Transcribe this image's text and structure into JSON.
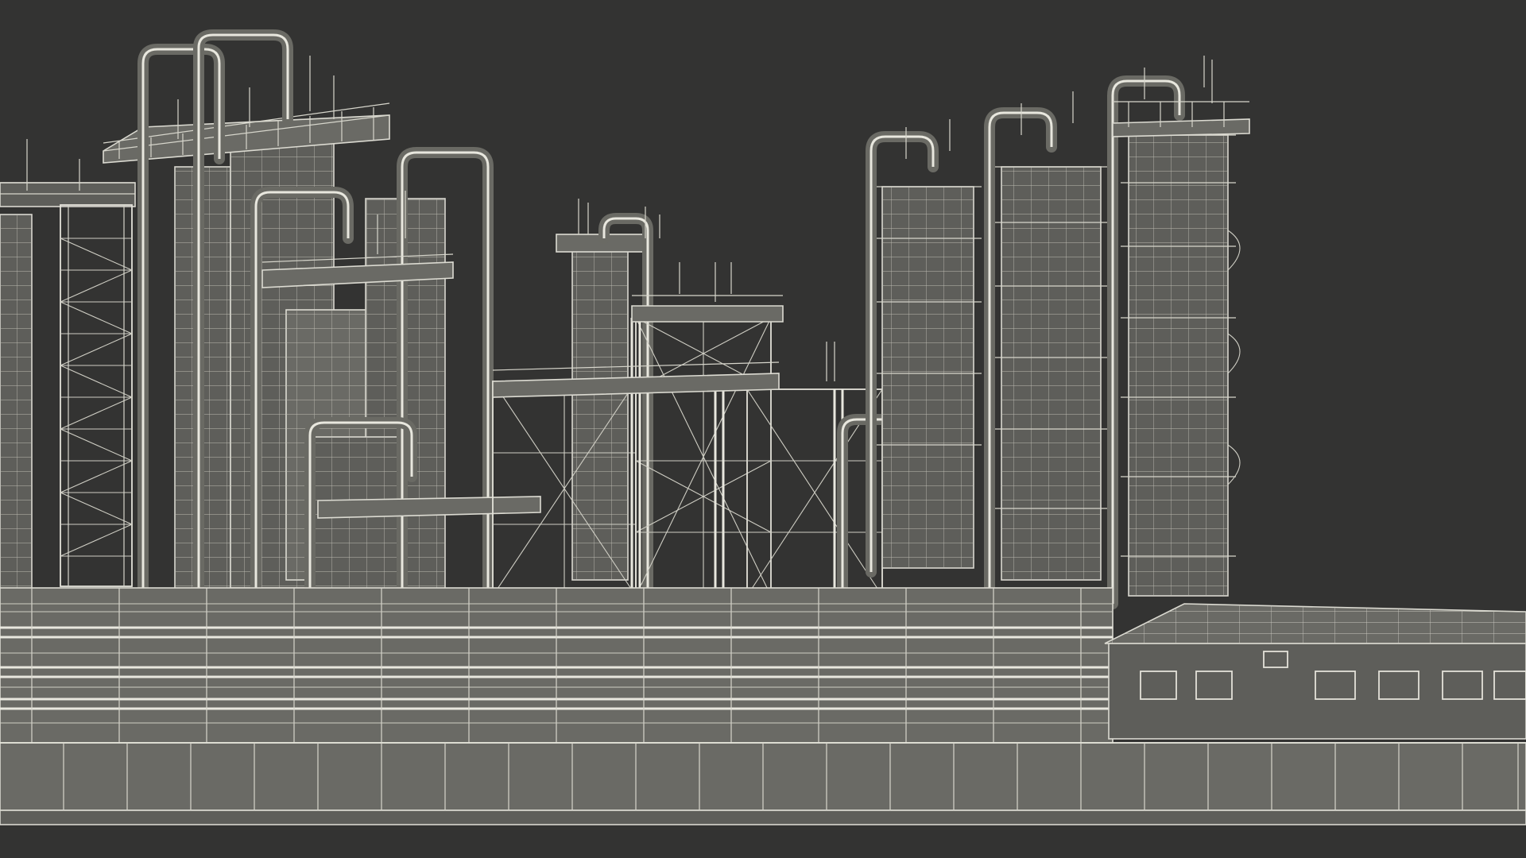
{
  "scene": {
    "subject": "industrial-refinery-wireframe",
    "colors": {
      "background": "#333332",
      "structure_fill": "#5e5e5a",
      "wire": "#d9d8cf"
    }
  }
}
